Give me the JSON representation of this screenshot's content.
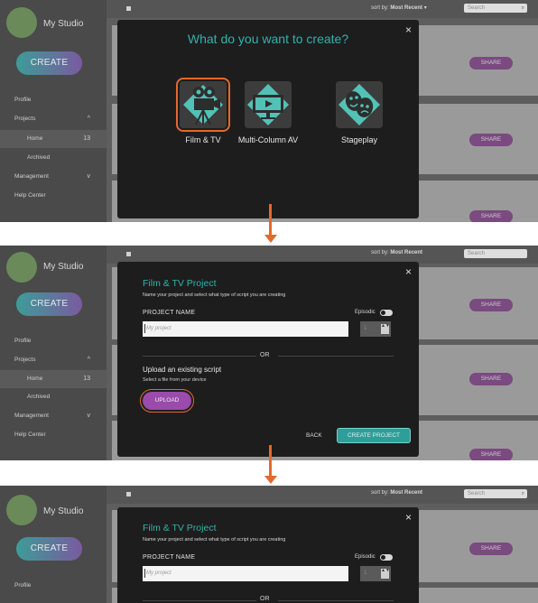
{
  "sidebar": {
    "studio_name": "My Studio",
    "create_label": "CREATE",
    "profile_label": "Profile",
    "projects_label": "Projects",
    "home_label": "Home",
    "home_count": "13",
    "archived_label": "Archived",
    "management_label": "Management",
    "help_label": "Help Center",
    "chevron_up": "^",
    "chevron_down": "v"
  },
  "topbar": {
    "sort_label": "sort by:",
    "sort_value": "Most Recent",
    "sort_caret": "▾",
    "search_placeholder": "Search",
    "search_glyph": "⌕"
  },
  "card": {
    "share_label": "SHARE"
  },
  "modal1": {
    "title": "What do you want to create?",
    "close": "×",
    "options": [
      {
        "label": "Film & TV"
      },
      {
        "label": "Multi-Column AV"
      },
      {
        "label": "Stageplay"
      }
    ]
  },
  "modal2": {
    "title": "Film & TV Project",
    "close": "×",
    "subtitle": "Name your project and select what type of script you are creating",
    "name_label": "PROJECT NAME",
    "episodic_label": "Episodic",
    "name_placeholder": "My project",
    "episodes_value": "1",
    "stepper_arrows": "▲▼",
    "or_label": "OR",
    "upload_title": "Upload an existing script",
    "upload_sub": "Select a file from your device",
    "upload_label": "UPLOAD",
    "back_label": "BACK",
    "create_label": "CREATE PROJECT"
  },
  "colors": {
    "accent_teal": "#2fb3ab",
    "highlight_orange": "#e3692c",
    "upload_purple": "#9a4bab",
    "share_purple": "#7a4a80"
  }
}
